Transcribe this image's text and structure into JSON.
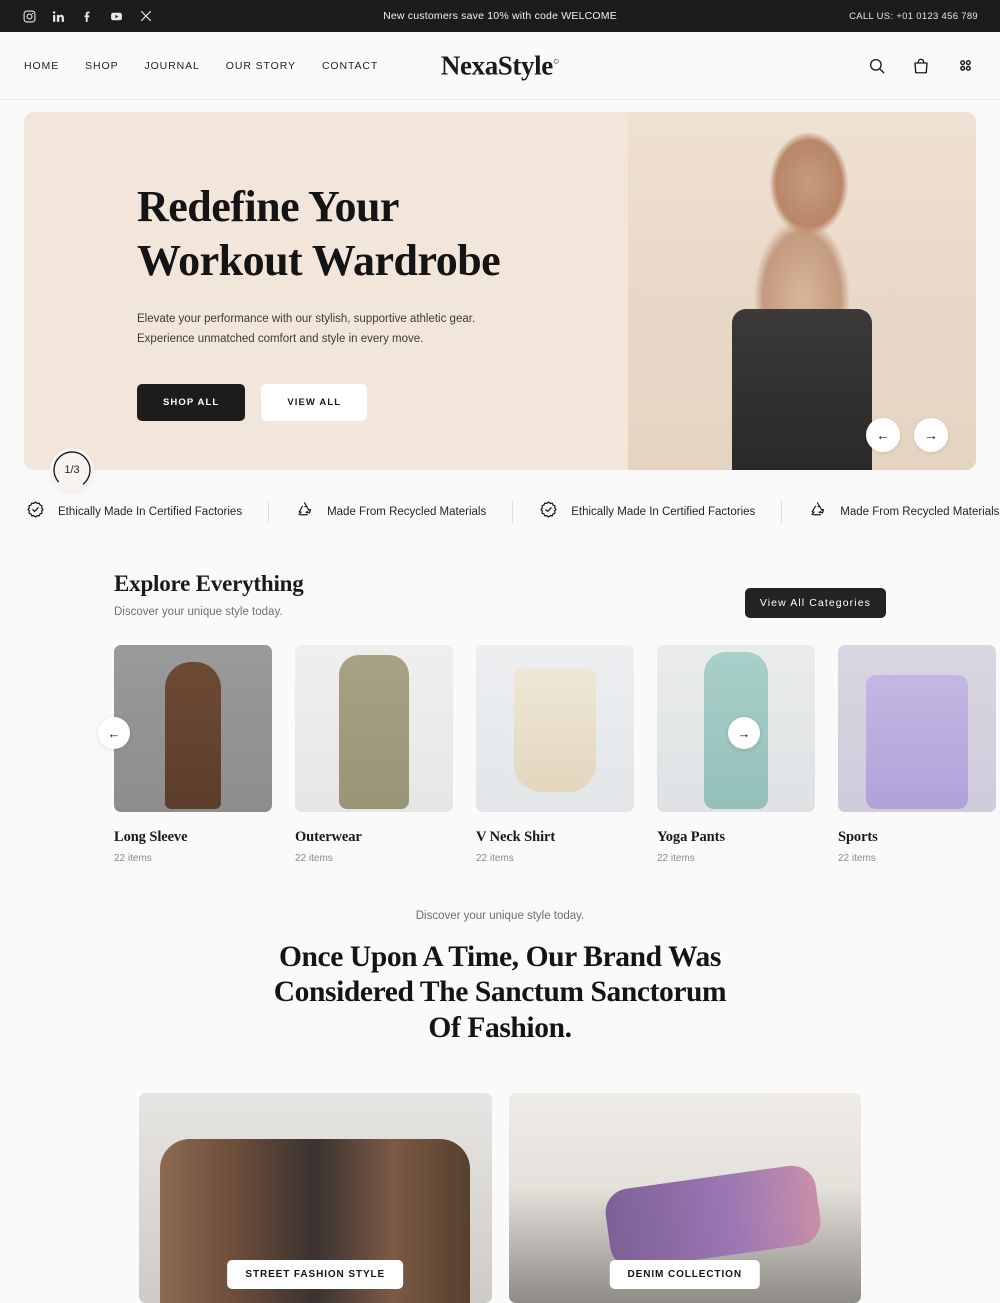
{
  "announcement": {
    "socials": [
      {
        "name": "instagram-icon",
        "label": "Instagram"
      },
      {
        "name": "linkedin-icon",
        "label": "LinkedIn"
      },
      {
        "name": "facebook-icon",
        "label": "Facebook"
      },
      {
        "name": "youtube-icon",
        "label": "YouTube"
      },
      {
        "name": "x-icon",
        "label": "X"
      }
    ],
    "promo": "New customers save 10% with code WELCOME",
    "phone": "CALL US: +01 0123 456 789"
  },
  "header": {
    "nav": [
      {
        "label": "HOME"
      },
      {
        "label": "SHOP"
      },
      {
        "label": "JOURNAL"
      },
      {
        "label": "OUR STORY"
      },
      {
        "label": "CONTACT"
      }
    ],
    "brand": "NexaStyle",
    "brand_mark": "○",
    "icons": [
      "search-icon",
      "shopping-bag-icon",
      "grid-menu-icon"
    ]
  },
  "hero": {
    "title_line1": "Redefine Your",
    "title_line2": "Workout Wardrobe",
    "subtitle": "Elevate your performance with our stylish, supportive athletic gear. Experience unmatched comfort and style in every move.",
    "primary_button": "SHOP ALL",
    "secondary_button": "VIEW ALL",
    "slide_counter": "1/3",
    "prev_arrow": "←",
    "next_arrow": "→",
    "background_color": "#f2e6da"
  },
  "strip": {
    "items": [
      {
        "icon": "badge-check-icon",
        "label": "Ethically Made In Certified Factories"
      },
      {
        "icon": "recycle-icon",
        "label": "Made From Recycled Materials"
      },
      {
        "icon": "badge-check-icon",
        "label": "Ethically Made In Certified Factories"
      },
      {
        "icon": "recycle-icon",
        "label": "Made From Recycled Materials"
      }
    ]
  },
  "explore": {
    "title": "Explore Everything",
    "description": "Discover your unique style today.",
    "view_all_button": "View All Categories",
    "prev_arrow": "←",
    "next_arrow": "→",
    "categories": [
      {
        "name": "Long Sleeve",
        "items": "22 items",
        "skin": "sk-a"
      },
      {
        "name": "Outerwear",
        "items": "22 items",
        "skin": "sk-b"
      },
      {
        "name": "V Neck Shirt",
        "items": "22 items",
        "skin": "sk-c"
      },
      {
        "name": "Yoga Pants",
        "items": "22 items",
        "skin": "sk-d"
      },
      {
        "name": "Sports",
        "items": "22 items",
        "skin": "sk-e"
      }
    ]
  },
  "story": {
    "eyebrow": "Discover your unique style today.",
    "heading_line1": "Once Upon A Time, Our Brand Was",
    "heading_line2": "Considered The Sanctum Sanctorum",
    "heading_line3": "Of Fashion."
  },
  "gallery": {
    "cards": [
      {
        "badge": "STREET FASHION STYLE",
        "skin": "sk-g1"
      },
      {
        "badge": "DENIM COLLECTION",
        "skin": "sk-g2"
      }
    ]
  },
  "theme": {
    "page_bg": "#fafafa",
    "dark": "#1c1c1c",
    "cream": "#f2e6da",
    "muted": "#8a8a8a"
  }
}
